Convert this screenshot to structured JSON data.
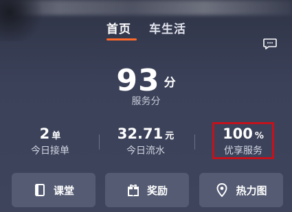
{
  "header": {
    "tabs": [
      {
        "label": "首页",
        "active": true
      },
      {
        "label": "车生活",
        "active": false
      }
    ],
    "message_icon": "chat-bubble-icon"
  },
  "score": {
    "value": "93",
    "unit": "分",
    "label": "服务分"
  },
  "stats": [
    {
      "value": "2",
      "unit": "单",
      "label": "今日接单"
    },
    {
      "value": "32.71",
      "unit": "元",
      "label": "今日流水"
    },
    {
      "value": "100",
      "unit": "%",
      "label": "优享服务",
      "highlighted": true
    }
  ],
  "buttons": [
    {
      "label": "课堂",
      "icon": "book-icon"
    },
    {
      "label": "奖励",
      "icon": "gift-icon"
    },
    {
      "label": "热力图",
      "icon": "location-pin-icon"
    }
  ],
  "colors": {
    "accent": "#ff6a2b",
    "highlight_border": "#c4121c",
    "button_bg": "#545b73"
  }
}
